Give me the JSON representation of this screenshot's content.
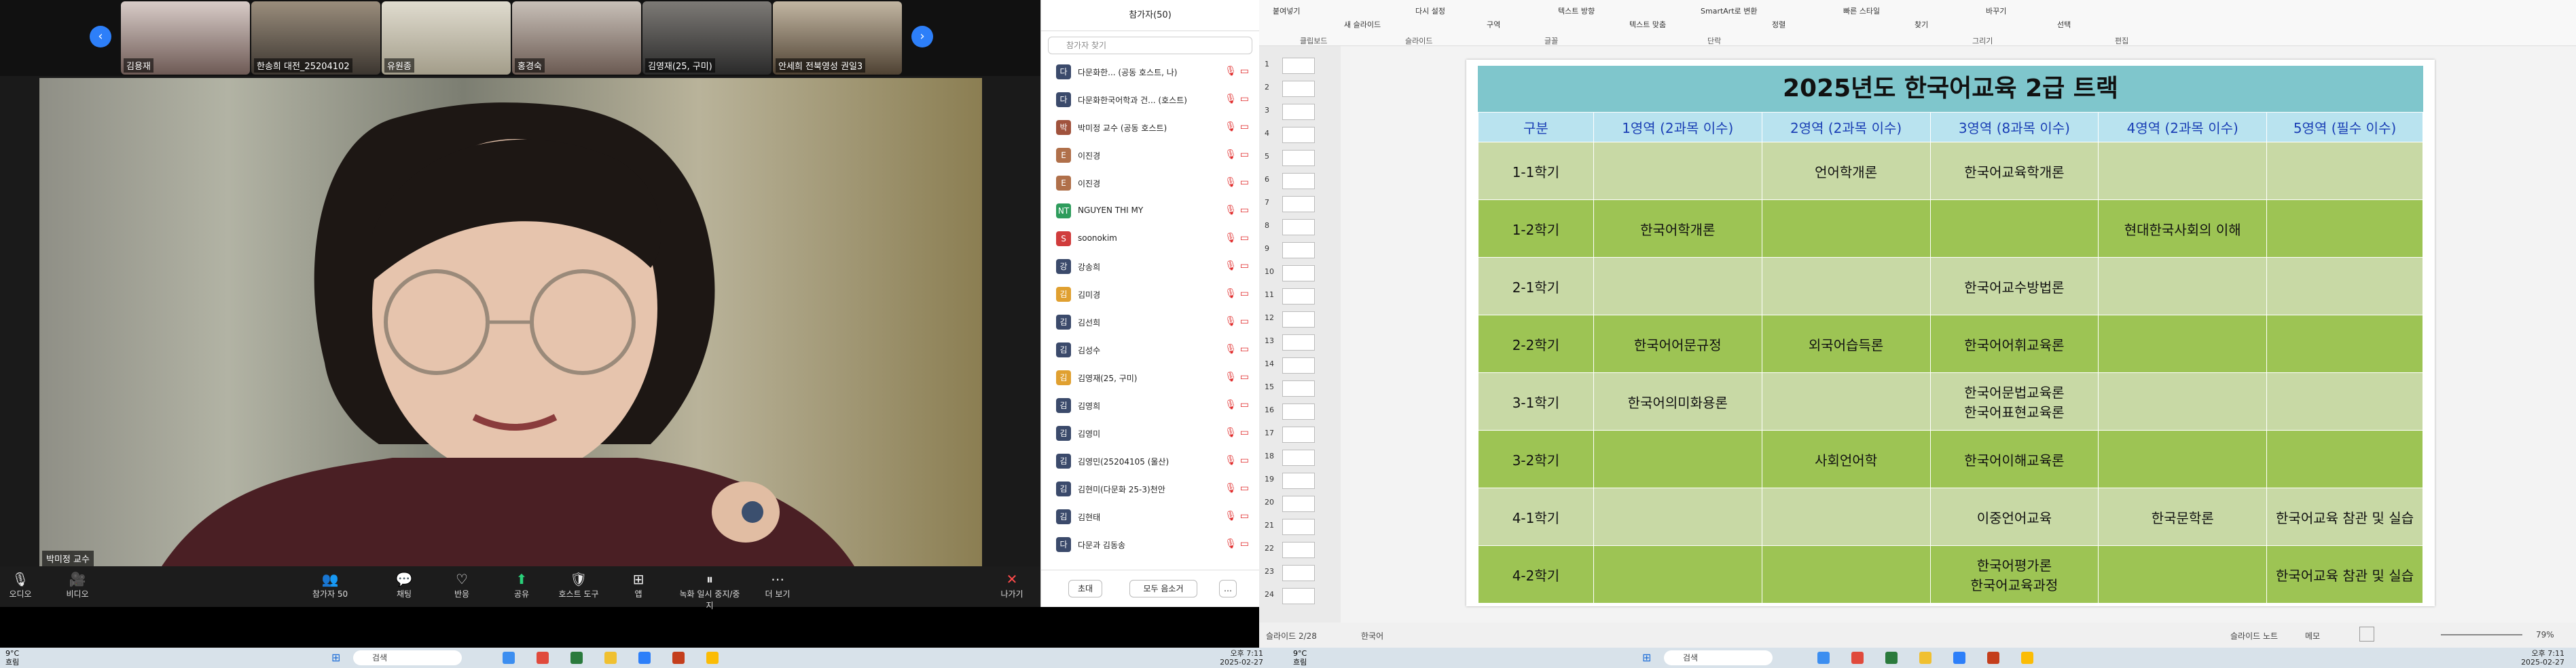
{
  "zoom": {
    "participants_strip": [
      {
        "name": "김용재"
      },
      {
        "name": "한송희 대전_25204102"
      },
      {
        "name": "유원종"
      },
      {
        "name": "홍경숙"
      },
      {
        "name": "김영재(25, 구미)"
      },
      {
        "name": "안세희 전북영성 권일3"
      }
    ],
    "speaker_label": "박미정 교수",
    "controls": [
      {
        "label": "오디오",
        "icon": "🎙"
      },
      {
        "label": "비디오",
        "icon": "🎥"
      },
      {
        "label": "참가자",
        "icon": "👥",
        "badge": "50"
      },
      {
        "label": "채팅",
        "icon": "💬"
      },
      {
        "label": "반응",
        "icon": "♡"
      },
      {
        "label": "공유",
        "icon": "⬆"
      },
      {
        "label": "호스트 도구",
        "icon": "🛡"
      },
      {
        "label": "앱",
        "icon": "⊞"
      },
      {
        "label": "녹화 일시 중지/중지",
        "icon": "⏸"
      },
      {
        "label": "더 보기",
        "icon": "⋯"
      },
      {
        "label": "나가기",
        "icon": "✕"
      }
    ]
  },
  "panel": {
    "title": "참가자(50)",
    "search_placeholder": "참가자 찾기",
    "participants": [
      {
        "name": "다문화한... (공동 호스트, 나)",
        "avatar": "다",
        "color": "#3b4a6b"
      },
      {
        "name": "다문화한국어학과 건... (호스트)",
        "avatar": "다",
        "color": "#3b4a6b"
      },
      {
        "name": "박미정 교수 (공동 호스트)",
        "avatar": "박",
        "color": "#a0523c"
      },
      {
        "name": "이진경",
        "avatar": "E",
        "color": "#b0704a"
      },
      {
        "name": "이진경",
        "avatar": "E",
        "color": "#b0704a"
      },
      {
        "name": "NGUYEN THI MY",
        "avatar": "NT",
        "color": "#2e9c5c"
      },
      {
        "name": "soonokim",
        "avatar": "S",
        "color": "#d03c3c"
      },
      {
        "name": "강송희",
        "avatar": "강",
        "color": "#3b4a6b"
      },
      {
        "name": "김미경",
        "avatar": "김",
        "color": "#e0a030"
      },
      {
        "name": "김선희",
        "avatar": "김",
        "color": "#3b4a6b"
      },
      {
        "name": "김성수",
        "avatar": "김",
        "color": "#3b4a6b"
      },
      {
        "name": "김영재(25, 구미)",
        "avatar": "김",
        "color": "#e0a030"
      },
      {
        "name": "김영희",
        "avatar": "김",
        "color": "#3b4a6b"
      },
      {
        "name": "김영미",
        "avatar": "김",
        "color": "#3b4a6b"
      },
      {
        "name": "김영민(25204105 (울산)",
        "avatar": "김",
        "color": "#3b4a6b"
      },
      {
        "name": "김현미(다문화 25-3)천안",
        "avatar": "김",
        "color": "#3b4a6b"
      },
      {
        "name": "김현태",
        "avatar": "김",
        "color": "#3b4a6b"
      },
      {
        "name": "다문과 김동송",
        "avatar": "다",
        "color": "#3b4a6b"
      }
    ],
    "invite_label": "초대",
    "mute_all_label": "모두 음소거",
    "more_label": "…"
  },
  "ppt": {
    "ribbon_groups": [
      "클립보드",
      "슬라이드",
      "글꼴",
      "단락",
      "그리기",
      "편집"
    ],
    "ribbon_items": [
      "붙여넣기",
      "새 슬라이드",
      "다시 설정",
      "구역",
      "텍스트 방향",
      "텍스트 맞춤",
      "SmartArt로 변환",
      "정렬",
      "빠른 스타일",
      "찾기",
      "바꾸기",
      "선택"
    ],
    "slide_numbers": [
      "1",
      "2",
      "3",
      "4",
      "5",
      "6",
      "7",
      "8",
      "9",
      "10",
      "11",
      "12",
      "13",
      "14",
      "15",
      "16",
      "17",
      "18",
      "19",
      "20",
      "21",
      "22",
      "23",
      "24"
    ],
    "title": "2025년도 한국어교육 2급 트랙",
    "headers": [
      "구분",
      "1영역 (2과목 이수)",
      "2영역 (2과목 이수)",
      "3영역 (8과목 이수)",
      "4영역 (2과목 이수)",
      "5영역 (필수 이수)"
    ],
    "rows": [
      [
        "1-1학기",
        "",
        "언어학개론",
        "한국어교육학개론",
        "",
        ""
      ],
      [
        "1-2학기",
        "한국어학개론",
        "",
        "",
        "현대한국사회의 이해",
        ""
      ],
      [
        "2-1학기",
        "",
        "",
        "한국어교수방법론",
        "",
        ""
      ],
      [
        "2-2학기",
        "한국어어문규정",
        "외국어습득론",
        "한국어어휘교육론",
        "",
        ""
      ],
      [
        "3-1학기",
        "한국어의미화용론",
        "",
        "한국어문법교육론\n한국어표현교육론",
        "",
        ""
      ],
      [
        "3-2학기",
        "",
        "사회언어학",
        "한국어이해교육론",
        "",
        ""
      ],
      [
        "4-1학기",
        "",
        "",
        "이중언어교육",
        "한국문학론",
        "한국어교육 참관 및 실습"
      ],
      [
        "4-2학기",
        "",
        "",
        "한국어평가론\n한국어교육과정",
        "",
        "한국어교육 참관 및 실습"
      ]
    ],
    "status_left": "슬라이드 2/28",
    "status_lang": "한국어",
    "status_notes": "슬라이드 노트",
    "status_comments": "메모",
    "zoom": "79%"
  },
  "taskbar": {
    "left": {
      "weather_temp": "9°C",
      "weather_desc": "흐림",
      "search": "검색",
      "time": "오후 7:11",
      "date": "2025-02-27"
    },
    "right": {
      "weather_temp": "9°C",
      "weather_desc": "흐림",
      "search": "검색",
      "time": "오후 7:11",
      "date": "2025-02-27"
    }
  },
  "colors": {
    "title_bg": "#7fc6cc",
    "header_bg": "#b9e3ef",
    "row_light": "#c8d9a5",
    "row_dark": "#9dc454",
    "zoom_blue": "#2d7ff9"
  }
}
